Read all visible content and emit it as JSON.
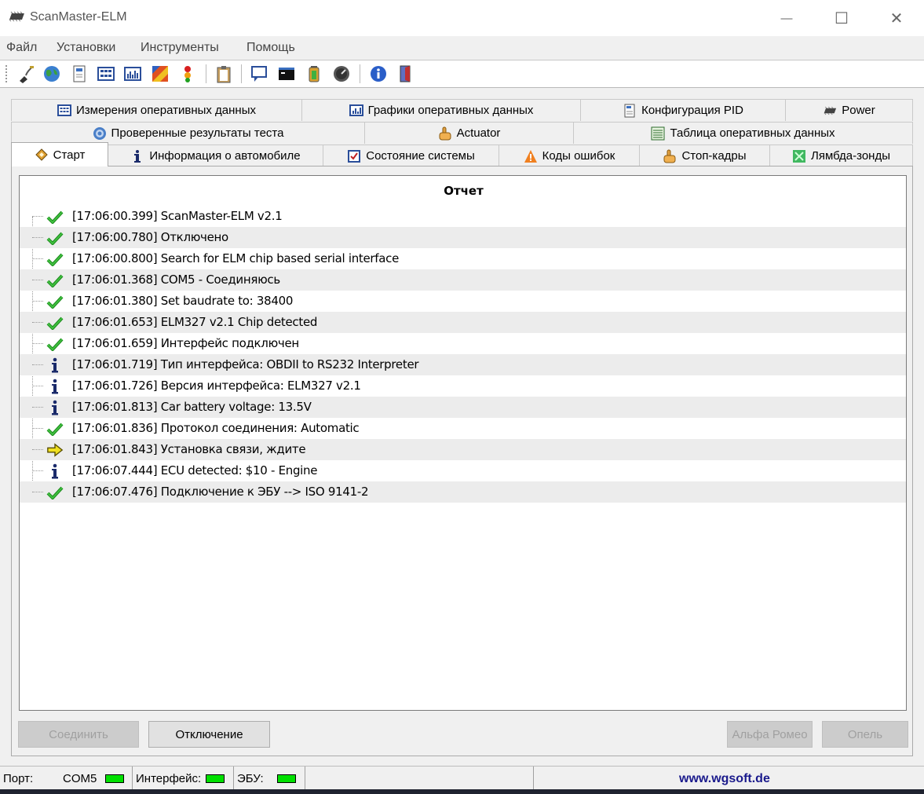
{
  "window": {
    "title": "ScanMaster-ELM",
    "minimize": "—",
    "maximize": "☐",
    "close": "✕",
    "app_icon": "chip-icon"
  },
  "menu": [
    "Файл",
    "Установки",
    "Инструменты",
    "Помощь"
  ],
  "toolbar_icons": [
    "connect-plug-icon",
    "globe-icon",
    "document-icon",
    "grid-icon",
    "chart-icon",
    "pattern-icon",
    "traffic-light-icon",
    "clipboard-icon",
    "chat-icon",
    "terminal-icon",
    "battery-icon",
    "speedometer-icon",
    "info-icon",
    "exit-door-icon"
  ],
  "tabs": {
    "row1": [
      {
        "label": "Измерения оперативных данных",
        "icon": "grid-icon"
      },
      {
        "label": "Графики оперативных данных",
        "icon": "chart-icon"
      },
      {
        "label": "Конфигурация PID",
        "icon": "document-icon"
      },
      {
        "label": "Power",
        "icon": "chip-icon"
      }
    ],
    "row2": [
      {
        "label": "Проверенные результаты теста",
        "icon": "gear-icon"
      },
      {
        "label": "Actuator",
        "icon": "hand-icon"
      },
      {
        "label": "Таблица оперативных данных",
        "icon": "table-icon"
      }
    ],
    "row3": [
      {
        "label": "Старт",
        "icon": "start-icon"
      },
      {
        "label": "Информация о автомобиле",
        "icon": "info-icon"
      },
      {
        "label": "Состояние системы",
        "icon": "checkbox-icon"
      },
      {
        "label": "Коды ошибок",
        "icon": "warning-icon"
      },
      {
        "label": "Стоп-кадры",
        "icon": "hand-icon"
      },
      {
        "label": "Лямбда-зонды",
        "icon": "lambda-icon"
      }
    ],
    "active": "Старт"
  },
  "report": {
    "title": "Отчет",
    "entries": [
      {
        "icon": "check",
        "text": "[17:06:00.399] ScanMaster-ELM v2.1"
      },
      {
        "icon": "check",
        "text": "[17:06:00.780] Отключено"
      },
      {
        "icon": "check",
        "text": "[17:06:00.800] Search for ELM chip based serial interface"
      },
      {
        "icon": "check",
        "text": "[17:06:01.368] COM5 - Соединяюсь"
      },
      {
        "icon": "check",
        "text": "[17:06:01.380] Set baudrate to: 38400"
      },
      {
        "icon": "check",
        "text": "[17:06:01.653] ELM327 v2.1 Chip detected"
      },
      {
        "icon": "check",
        "text": "[17:06:01.659] Интерфейс подключен"
      },
      {
        "icon": "info",
        "text": "[17:06:01.719] Тип интерфейса: OBDII to RS232 Interpreter"
      },
      {
        "icon": "info",
        "text": "[17:06:01.726] Версия интерфейса: ELM327 v2.1"
      },
      {
        "icon": "info",
        "text": "[17:06:01.813] Car battery voltage: 13.5V"
      },
      {
        "icon": "check",
        "text": "[17:06:01.836] Протокол соединения: Automatic"
      },
      {
        "icon": "arrow",
        "text": "[17:06:01.843] Установка связи, ждите"
      },
      {
        "icon": "info",
        "text": "[17:06:07.444] ECU detected: $10 - Engine"
      },
      {
        "icon": "check",
        "text": "[17:06:07.476] Подключение к ЭБУ --> ISO 9141-2"
      }
    ]
  },
  "buttons": {
    "connect": "Соединить",
    "disconnect": "Отключение",
    "alfa": "Альфа Ромео",
    "opel": "Опель"
  },
  "status": {
    "port_label": "Порт:",
    "port_value": "COM5",
    "interface_label": "Интерфейс:",
    "ecu_label": "ЭБУ:",
    "url": "www.wgsoft.de",
    "led_color": "#00e000"
  }
}
